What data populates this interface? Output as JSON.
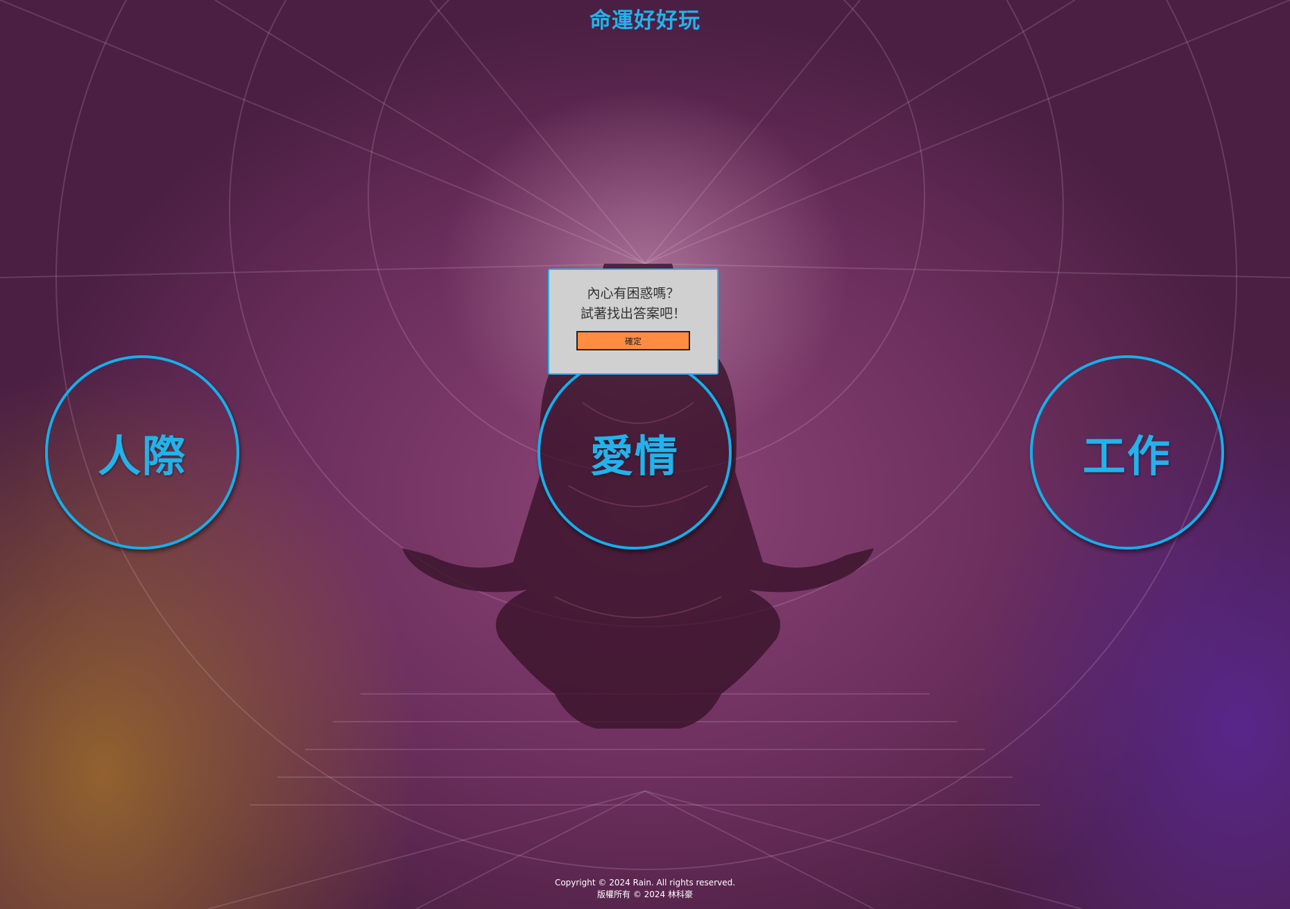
{
  "site": {
    "title": "命運好好玩"
  },
  "categories": [
    {
      "label": "人際"
    },
    {
      "label": "愛情"
    },
    {
      "label": "工作"
    }
  ],
  "dialog": {
    "line1": "內心有困惑嗎？",
    "line2": "試著找出答案吧！",
    "confirm_label": "確定"
  },
  "footer": {
    "copyright_en": "Copyright © 2024 Rain. All rights reserved.",
    "copyright_zh": "版權所有 © 2024 林科豪"
  },
  "colors": {
    "accent": "#22b3ec",
    "dialog_bg": "#d0d0d0",
    "confirm_bg": "#ff8c40"
  }
}
